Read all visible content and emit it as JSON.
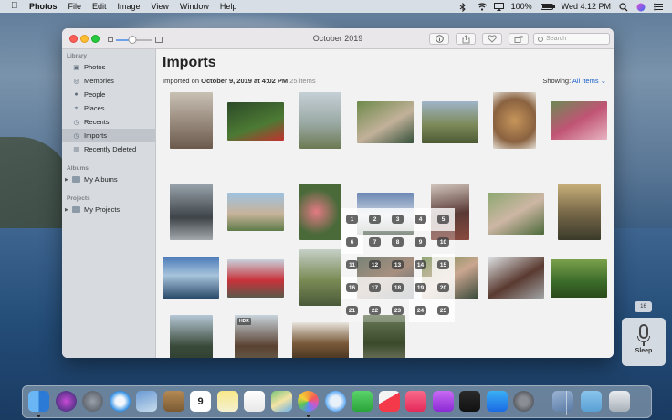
{
  "menubar": {
    "app_name": "Photos",
    "menus": [
      "File",
      "Edit",
      "Image",
      "View",
      "Window",
      "Help"
    ],
    "battery_percent": "100%",
    "clock": "Wed 4:12 PM",
    "battery_level": 1.0
  },
  "window": {
    "title": "October 2019",
    "zoom_level": 0.45,
    "search": {
      "placeholder": "Search",
      "value": ""
    }
  },
  "sidebar": {
    "sections": [
      {
        "label": "Library",
        "items": [
          "Photos",
          "Memories",
          "People",
          "Places",
          "Recents",
          "Imports",
          "Recently Deleted"
        ]
      },
      {
        "label": "Albums",
        "items": [
          "My Albums"
        ]
      },
      {
        "label": "Projects",
        "items": [
          "My Projects"
        ]
      }
    ],
    "active_item": "Imports"
  },
  "main": {
    "title": "Imports",
    "imported_prefix": "Imported on ",
    "imported_date": "October 9, 2019 at 4:02 PM",
    "item_count": "25 items",
    "showing_label": "Showing:",
    "showing_value": "All Items"
  },
  "hdr_badge": "HDR",
  "grid_labels": [
    "1",
    "2",
    "3",
    "4",
    "5",
    "6",
    "7",
    "8",
    "9",
    "10",
    "11",
    "12",
    "13",
    "14",
    "15",
    "16",
    "17",
    "18",
    "19",
    "20",
    "21",
    "22",
    "23",
    "24",
    "25"
  ],
  "voice_control": {
    "mini_label": "16",
    "sleep_label": "Sleep"
  },
  "dock": {
    "calendar_day": "9",
    "apps": [
      "finder-icon",
      "siri-icon",
      "launchpad-icon",
      "safari-icon",
      "preview-icon",
      "notes-app-icon",
      "calendar-icon",
      "stickies-icon",
      "reminders-icon",
      "maps-icon",
      "photos-icon",
      "messages-icon",
      "facetime-icon",
      "news-icon",
      "music-icon",
      "podcasts-icon",
      "tv-icon",
      "app-store-icon",
      "system-preferences-icon",
      "photo-viewer-icon",
      "downloads-folder-icon",
      "trash-icon"
    ]
  }
}
